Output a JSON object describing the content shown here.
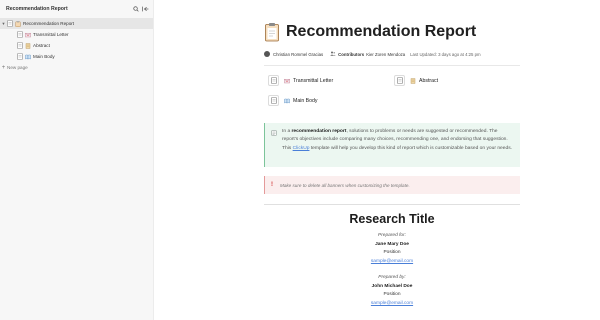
{
  "sidebar": {
    "title": "Recommendation Report",
    "tree": [
      {
        "label": "Recommendation Report",
        "active": true,
        "expanded": true
      },
      {
        "label": "Transmittal Letter"
      },
      {
        "label": "Abstract"
      },
      {
        "label": "Main Body"
      }
    ],
    "new_page": "New page"
  },
  "page": {
    "title": "Recommendation Report",
    "author": "Christian Rommel Gracias",
    "contributors_label": "Contributors",
    "contributors": "Kier Zoren Mendoza",
    "updated": "Last Updated: 3 days ago at 4:25 pm"
  },
  "links": {
    "transmittal": "Transmittal Letter",
    "abstract": "Abstract",
    "main_body": "Main Body"
  },
  "callout": {
    "t1": "In a ",
    "bold": "recommendation report",
    "t2": ", solutions to problems or needs are suggested or recommended. The report's objectives include comparing many choices, recommending one, and endorsing that suggestion. This ",
    "link": "ClickUp",
    "t3": " template will help you develop this kind of report which is customizable based on your needs."
  },
  "warning": {
    "icon": "!",
    "text": "Make sure to delete all banners when customizing the template."
  },
  "research": {
    "title": "Research Title",
    "for_label": "Prepared for:",
    "for_name": "Jane Mary Doe",
    "for_position": "Position",
    "for_email": "sample@email.com",
    "by_label": "Prepared by:",
    "by_name": "John Michael Doe",
    "by_position": "Position",
    "by_email": "sample@email.com"
  },
  "icons": {
    "search": "search-icon",
    "collapse": "collapse-sidebar-icon",
    "document": "document-icon",
    "contributors": "contributors-icon",
    "info": "info-icon"
  },
  "colors": {
    "callout_bg": "#ecf7f1",
    "callout_border": "#7cc49a",
    "warning_bg": "#fbeeee",
    "warning_accent": "#d23b3b",
    "link": "#4a7fd8"
  }
}
